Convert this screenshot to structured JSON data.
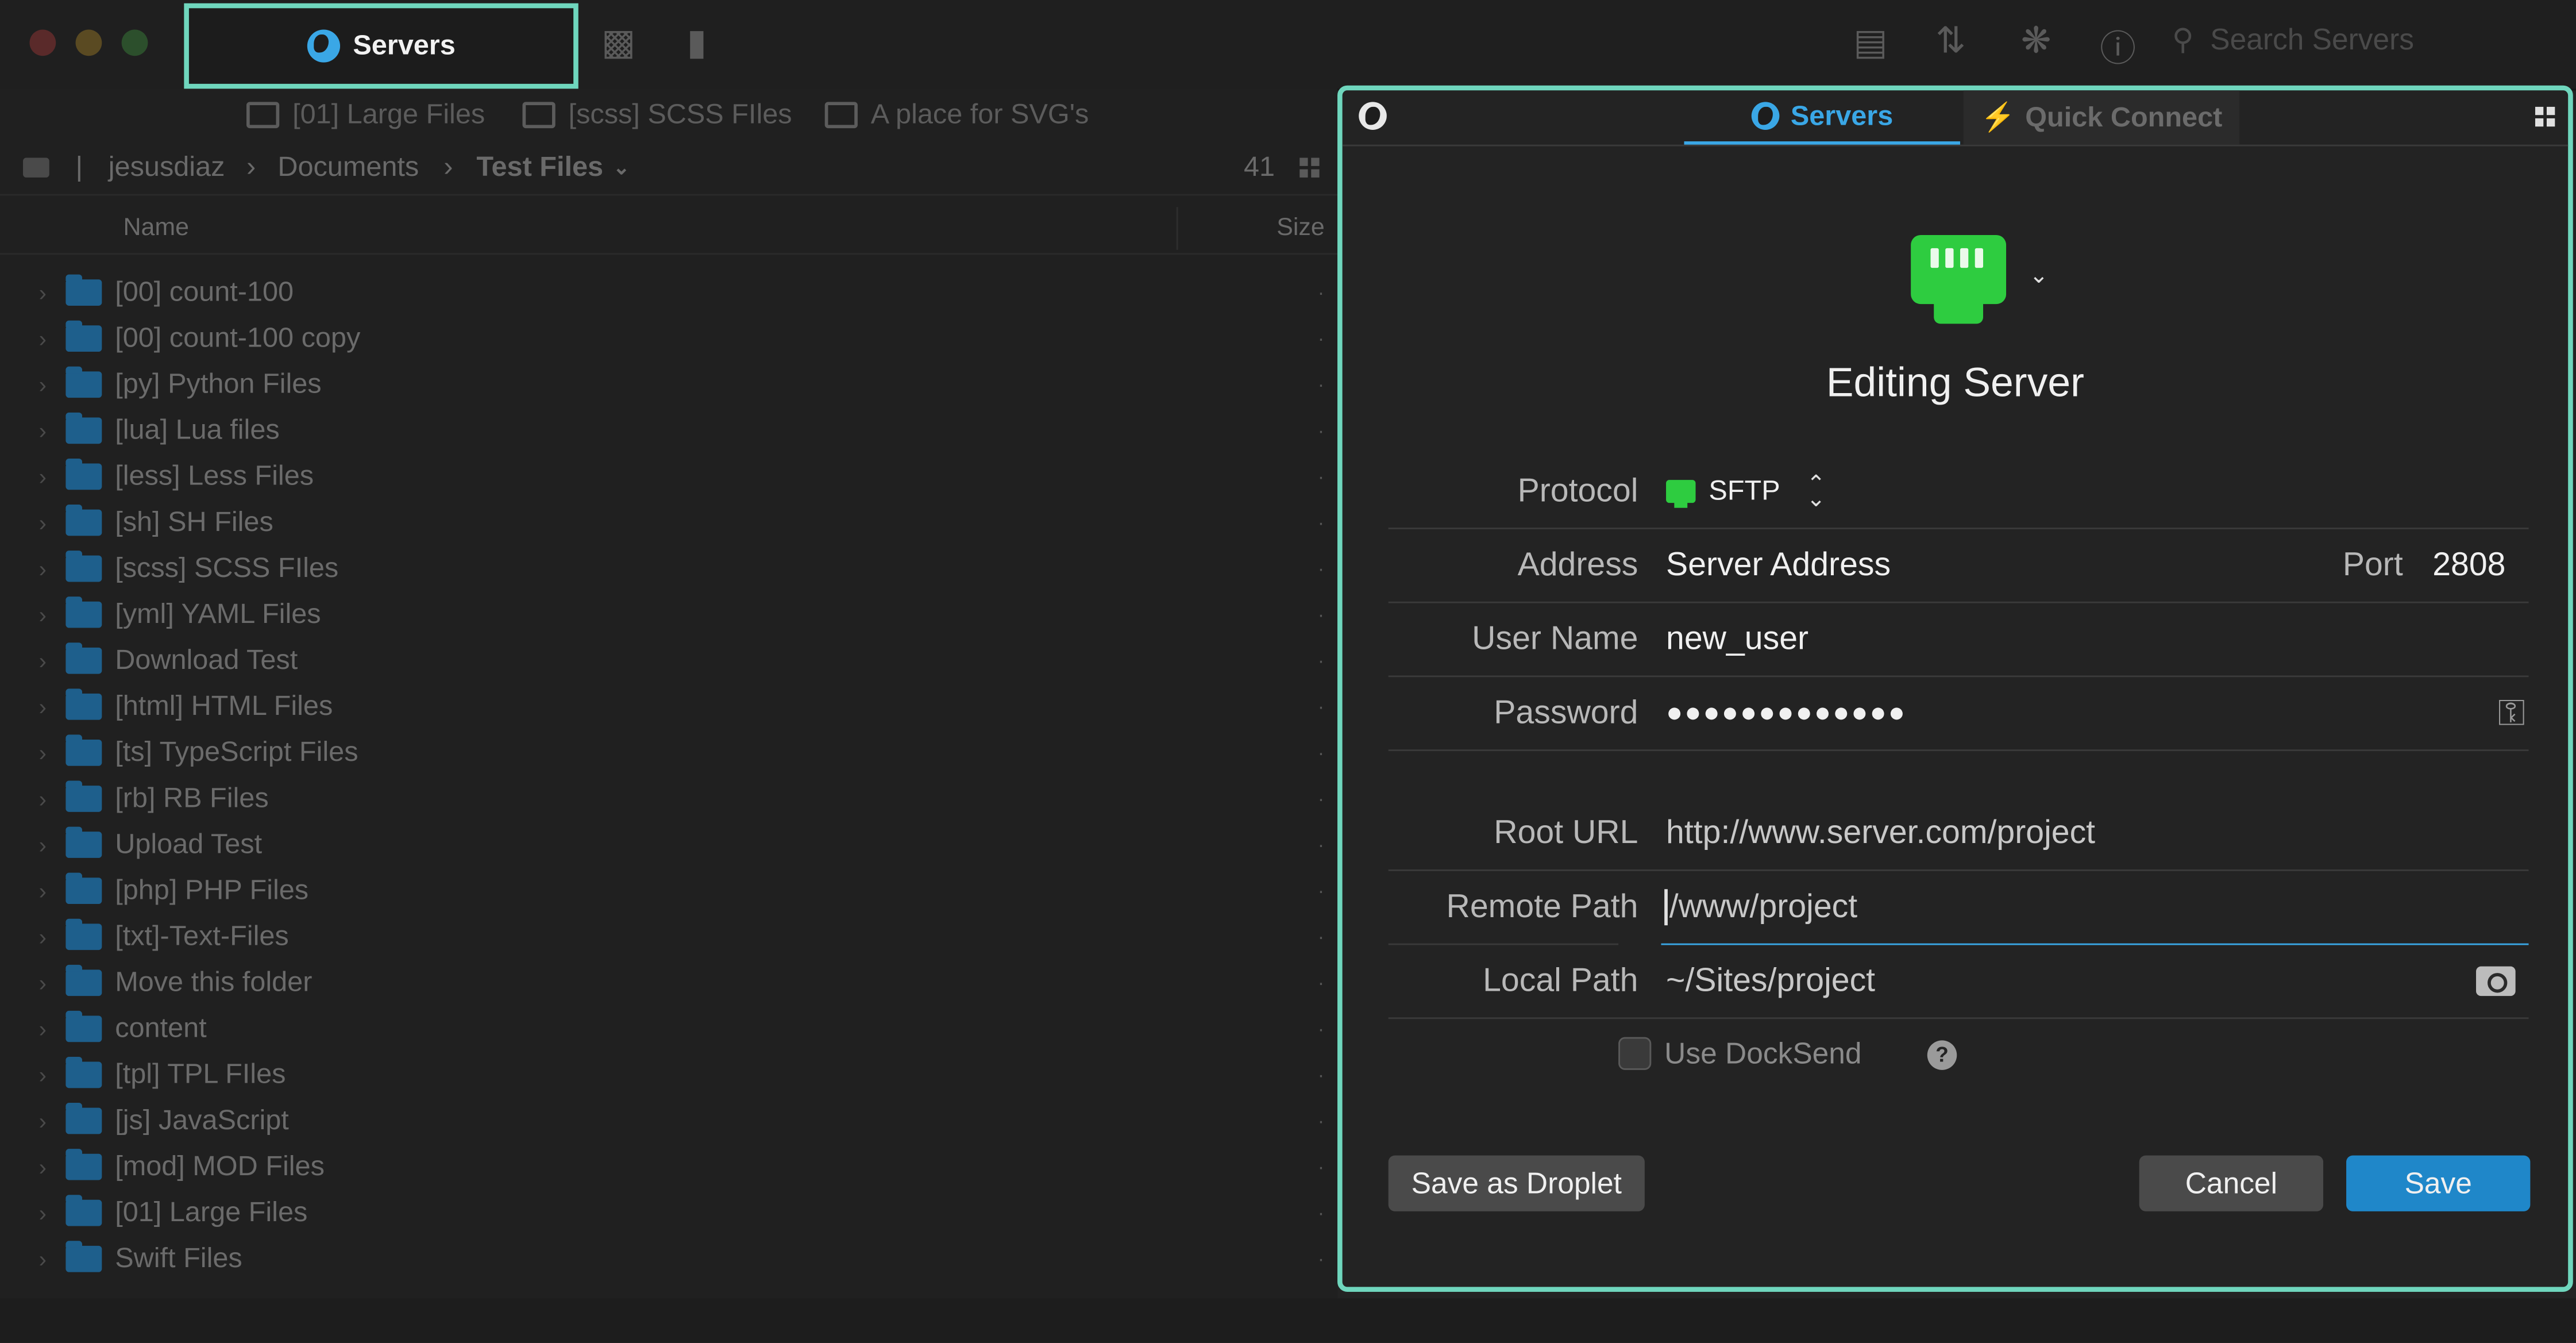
{
  "window": {
    "active_tab": "Servers",
    "search_placeholder": "Search Servers"
  },
  "bookmarks": [
    "[01] Large Files",
    "[scss] SCSS FIles",
    "A place for SVG's"
  ],
  "path": {
    "user": "jesusdiaz",
    "folder": "Documents",
    "current": "Test Files",
    "count": "41"
  },
  "columns": {
    "name": "Name",
    "size": "Size"
  },
  "files": [
    "[00] count-100",
    "[00] count-100 copy",
    "[py] Python Files",
    "[lua] Lua files",
    "[less] Less Files",
    "[sh] SH Files",
    "[scss] SCSS FIles",
    "[yml] YAML Files",
    "Download Test",
    "[html] HTML Files",
    "[ts] TypeScript Files",
    "[rb] RB Files",
    "Upload Test",
    "[php] PHP Files",
    "[txt]-Text-Files",
    "Move this folder",
    "content",
    "[tpl] TPL FIles",
    "[js] JavaScript",
    "[mod] MOD Files",
    "[01] Large Files",
    "Swift Files"
  ],
  "dialog": {
    "tabs": {
      "servers": "Servers",
      "quick_connect": "Quick Connect"
    },
    "title": "Editing Server",
    "protocol": {
      "label": "Protocol",
      "value": "SFTP"
    },
    "address": {
      "label": "Address",
      "value": "Server Address",
      "port_label": "Port",
      "port_value": "2808"
    },
    "username": {
      "label": "User Name",
      "value": "new_user"
    },
    "password": {
      "label": "Password",
      "value": "●●●●●●●●●●●●●"
    },
    "root_url": {
      "label": "Root URL",
      "value": "http://www.server.com/project"
    },
    "remote_path": {
      "label": "Remote Path",
      "value": "/www/project"
    },
    "local_path": {
      "label": "Local Path",
      "value": "~/Sites/project"
    },
    "docksend": {
      "label": "Use DockSend",
      "checked": false
    },
    "buttons": {
      "droplet": "Save as Droplet",
      "cancel": "Cancel",
      "save": "Save"
    }
  },
  "colors": {
    "accent": "#3aa7e6",
    "highlight": "#6fd6bd",
    "plug_green": "#2ecc40",
    "save_blue": "#1f87c9"
  },
  "icons": [
    "globe-icon",
    "folder-icon",
    "file-icon",
    "transfer-icon",
    "activity-icon",
    "info-icon",
    "search-icon",
    "grid-icon",
    "plug-icon",
    "key-icon",
    "folder-browse-icon",
    "help-icon",
    "lightning-icon"
  ]
}
